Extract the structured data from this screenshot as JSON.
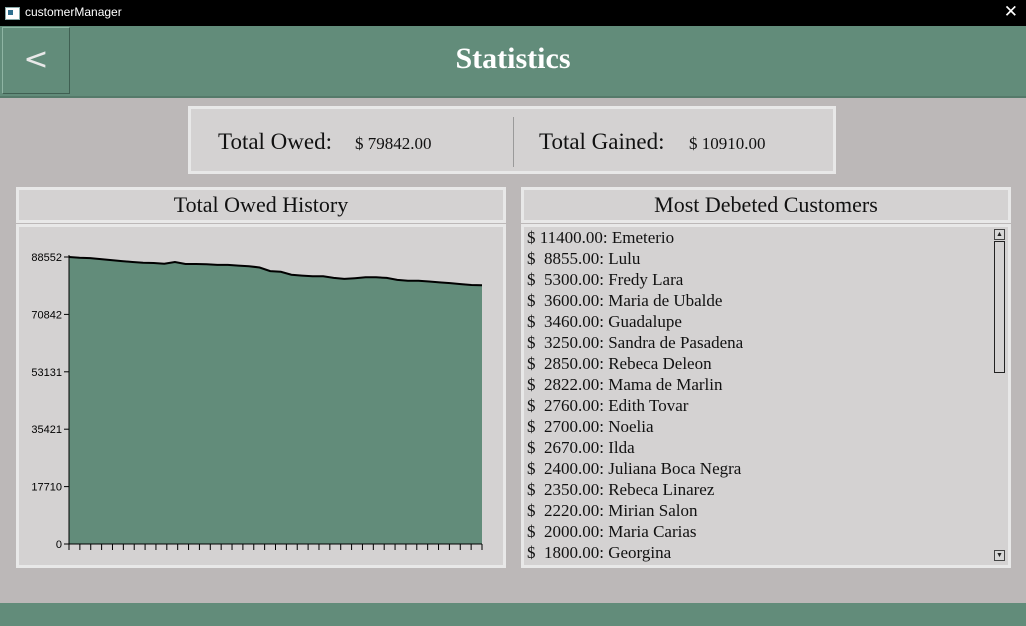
{
  "window": {
    "title": "customerManager",
    "close_glyph": "✕"
  },
  "header": {
    "back_label": "<",
    "title": "Statistics"
  },
  "totals": {
    "owed_label": "Total Owed:",
    "owed_value": "$ 79842.00",
    "gained_label": "Total Gained:",
    "gained_value": "$ 10910.00"
  },
  "history": {
    "title": "Total Owed History",
    "chart_data": {
      "type": "area",
      "title": "Total Owed History",
      "y_ticks": [
        0,
        17710,
        35421,
        53131,
        70842,
        88552
      ],
      "ylim": [
        0,
        88552
      ],
      "x_tick_count": 39,
      "values": [
        88552,
        88300,
        88200,
        87900,
        87600,
        87300,
        87000,
        86800,
        86700,
        86500,
        87000,
        86400,
        86400,
        86300,
        86100,
        86100,
        85900,
        85700,
        85300,
        84200,
        84000,
        83100,
        82800,
        82600,
        82600,
        82100,
        81800,
        82000,
        82300,
        82300,
        82100,
        81500,
        81200,
        81200,
        81000,
        80700,
        80500,
        80200,
        79900,
        79842
      ],
      "fill_color": "#628c7a",
      "line_color": "#000000",
      "grid": false
    }
  },
  "debtors": {
    "title": "Most Debeted Customers",
    "items": [
      "$ 11400.00: Emeterio",
      "$  8855.00: Lulu",
      "$  5300.00: Fredy Lara",
      "$  3600.00: Maria de Ubalde",
      "$  3460.00: Guadalupe",
      "$  3250.00: Sandra de Pasadena",
      "$  2850.00: Rebeca Deleon",
      "$  2822.00: Mama de Marlin",
      "$  2760.00: Edith Tovar",
      "$  2700.00: Noelia",
      "$  2670.00: Ilda",
      "$  2400.00: Juliana Boca Negra",
      "$  2350.00: Rebeca Linarez",
      "$  2220.00: Mirian Salon",
      "$  2000.00: Maria Carias",
      "$  1800.00: Georgina"
    ]
  },
  "colors": {
    "accent": "#628c7a",
    "background": "#bcb8b8",
    "panel": "#d4d2d2"
  }
}
